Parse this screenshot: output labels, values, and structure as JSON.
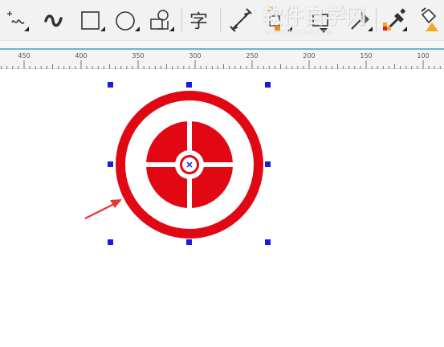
{
  "toolbar": {
    "tools": [
      {
        "icon": "freehand-tool-icon"
      },
      {
        "icon": "artistic-media-tool-icon"
      },
      {
        "icon": "rectangle-tool-icon"
      },
      {
        "icon": "ellipse-tool-icon"
      },
      {
        "icon": "basic-shapes-tool-icon"
      },
      {
        "icon": "text-tool-icon",
        "glyph": "字"
      },
      {
        "icon": "dimension-tool-icon"
      },
      {
        "icon": "interactive-fill-tool-icon"
      },
      {
        "icon": "eyedropper-tool-icon"
      },
      {
        "icon": "paint-bucket-tool-icon"
      }
    ]
  },
  "watermark": {
    "title": "软件自学网",
    "subtitle": "WWW.RJZXW.COM"
  },
  "ruler": {
    "labels": [
      "450",
      "400",
      "350",
      "300",
      "250",
      "200",
      "150",
      "100"
    ]
  },
  "colors": {
    "shape_red": "#e10713",
    "handle_blue": "#1a1ae6",
    "arrow_red": "#ee3333",
    "ruler_accent": "#6ab7c9"
  }
}
